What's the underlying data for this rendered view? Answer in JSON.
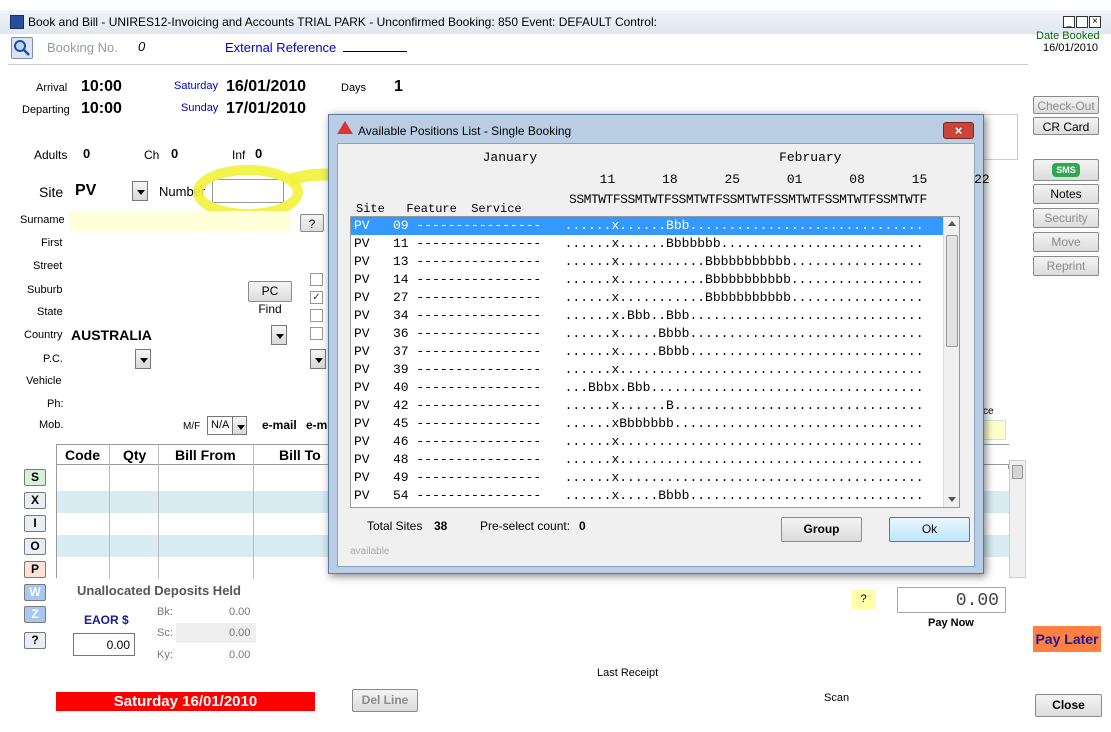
{
  "window": {
    "title": "Book and Bill - UNIRES12-Invoicing and Accounts TRIAL PARK - Unconfirmed Booking: 850 Event: DEFAULT Control:",
    "date_booked_label": "Date Booked",
    "date_booked": "16/01/2010"
  },
  "booking": {
    "booking_no_label": "Booking No.",
    "booking_no": "0",
    "external_ref_label": "External Reference"
  },
  "dates": {
    "arrival_label": "Arrival",
    "arrival_time": "10:00",
    "arrival_day": "Saturday",
    "arrival_date": "16/01/2010",
    "days_label": "Days",
    "days": "1",
    "departing_label": "Departing",
    "departing_time": "10:00",
    "departing_day": "Sunday",
    "departing_date": "17/01/2010"
  },
  "guests": {
    "adults_label": "Adults",
    "adults": "0",
    "children_label": "Ch",
    "children": "0",
    "infants_label": "Inf",
    "infants": "0"
  },
  "site": {
    "label": "Site",
    "value": "PV",
    "number_label": "Number",
    "number": ""
  },
  "form": {
    "surname": "Surname",
    "first": "First",
    "street": "Street",
    "suburb": "Suburb",
    "state": "State",
    "country_label": "Country",
    "country": "AUSTRALIA",
    "pc": "P.C.",
    "vehicle": "Vehicle",
    "ph": "Ph:",
    "mob": "Mob.",
    "mf_label": "M/F",
    "mf_value": "N/A",
    "email": "e-mail",
    "email2": "e-m",
    "pc_find": "PC Find",
    "help": "?",
    "ce": "ce"
  },
  "right_buttons": {
    "checkout": "Check-Out",
    "crcard": "CR Card",
    "sms": "SMS",
    "notes": "Notes",
    "security": "Security",
    "move": "Move",
    "reprint": "Reprint"
  },
  "grid": {
    "headers": [
      "Code",
      "Qty",
      "Bill From",
      "Bill To"
    ]
  },
  "side_buttons": [
    "S",
    "X",
    "I",
    "O",
    "P",
    "W",
    "Z",
    "?"
  ],
  "deposits": {
    "title": "Unallocated Deposits Held",
    "eaor_label": "EAOR $",
    "eaor_value": "0.00",
    "bk_label": "Bk:",
    "bk": "0.00",
    "sc_label": "Sc:",
    "sc": "0.00",
    "ky_label": "Ky:",
    "ky": "0.00"
  },
  "pay": {
    "help": "?",
    "amount": "0.00",
    "pay_now": "Pay Now",
    "pay_later": "Pay Later"
  },
  "footer": {
    "date_banner": "Saturday 16/01/2010",
    "del_line": "Del Line",
    "last_receipt": "Last Receipt",
    "scan": "Scan",
    "close": "Close"
  },
  "dialog": {
    "title": "Available Positions List - Single Booking",
    "months": "                 January                               February",
    "day_numbers": "                                11      18      25      01      08      15      22",
    "weekdays": "                              SSMTWTFSSMTWTFSSMTWTFSSMTWTFSSMTWTFSSMTWTFSSMTWTF",
    "col_header": "Site   Feature  Service",
    "rows": [
      "PV   09 ----------------   ......x......Bbb..............................",
      "PV   11 ----------------   ......x......Bbbbbbb..........................",
      "PV   13 ----------------   ......x...........Bbbbbbbbbbb.................",
      "PV   14 ----------------   ......x...........Bbbbbbbbbbb.................",
      "PV   27 ----------------   ......x...........Bbbbbbbbbbb.................",
      "PV   34 ----------------   ......x.Bbb..Bbb..............................",
      "PV   36 ----------------   ......x.....Bbbb..............................",
      "PV   37 ----------------   ......x.....Bbbb..............................",
      "PV   39 ----------------   ......x.......................................",
      "PV   40 ----------------   ...Bbbx.Bbb...................................",
      "PV   42 ----------------   ......x......B................................",
      "PV   45 ----------------   ......xBbbbbbb................................",
      "PV   46 ----------------   ......x.......................................",
      "PV   48 ----------------   ......x.......................................",
      "PV   49 ----------------   ......x.......................................",
      "PV   54 ----------------   ......x.....Bbbb.............................."
    ],
    "total_sites_label": "Total Sites",
    "total_sites": "38",
    "preselect_label": "Pre-select count:",
    "preselect": "0",
    "available": "available",
    "group": "Group",
    "ok": "Ok"
  }
}
